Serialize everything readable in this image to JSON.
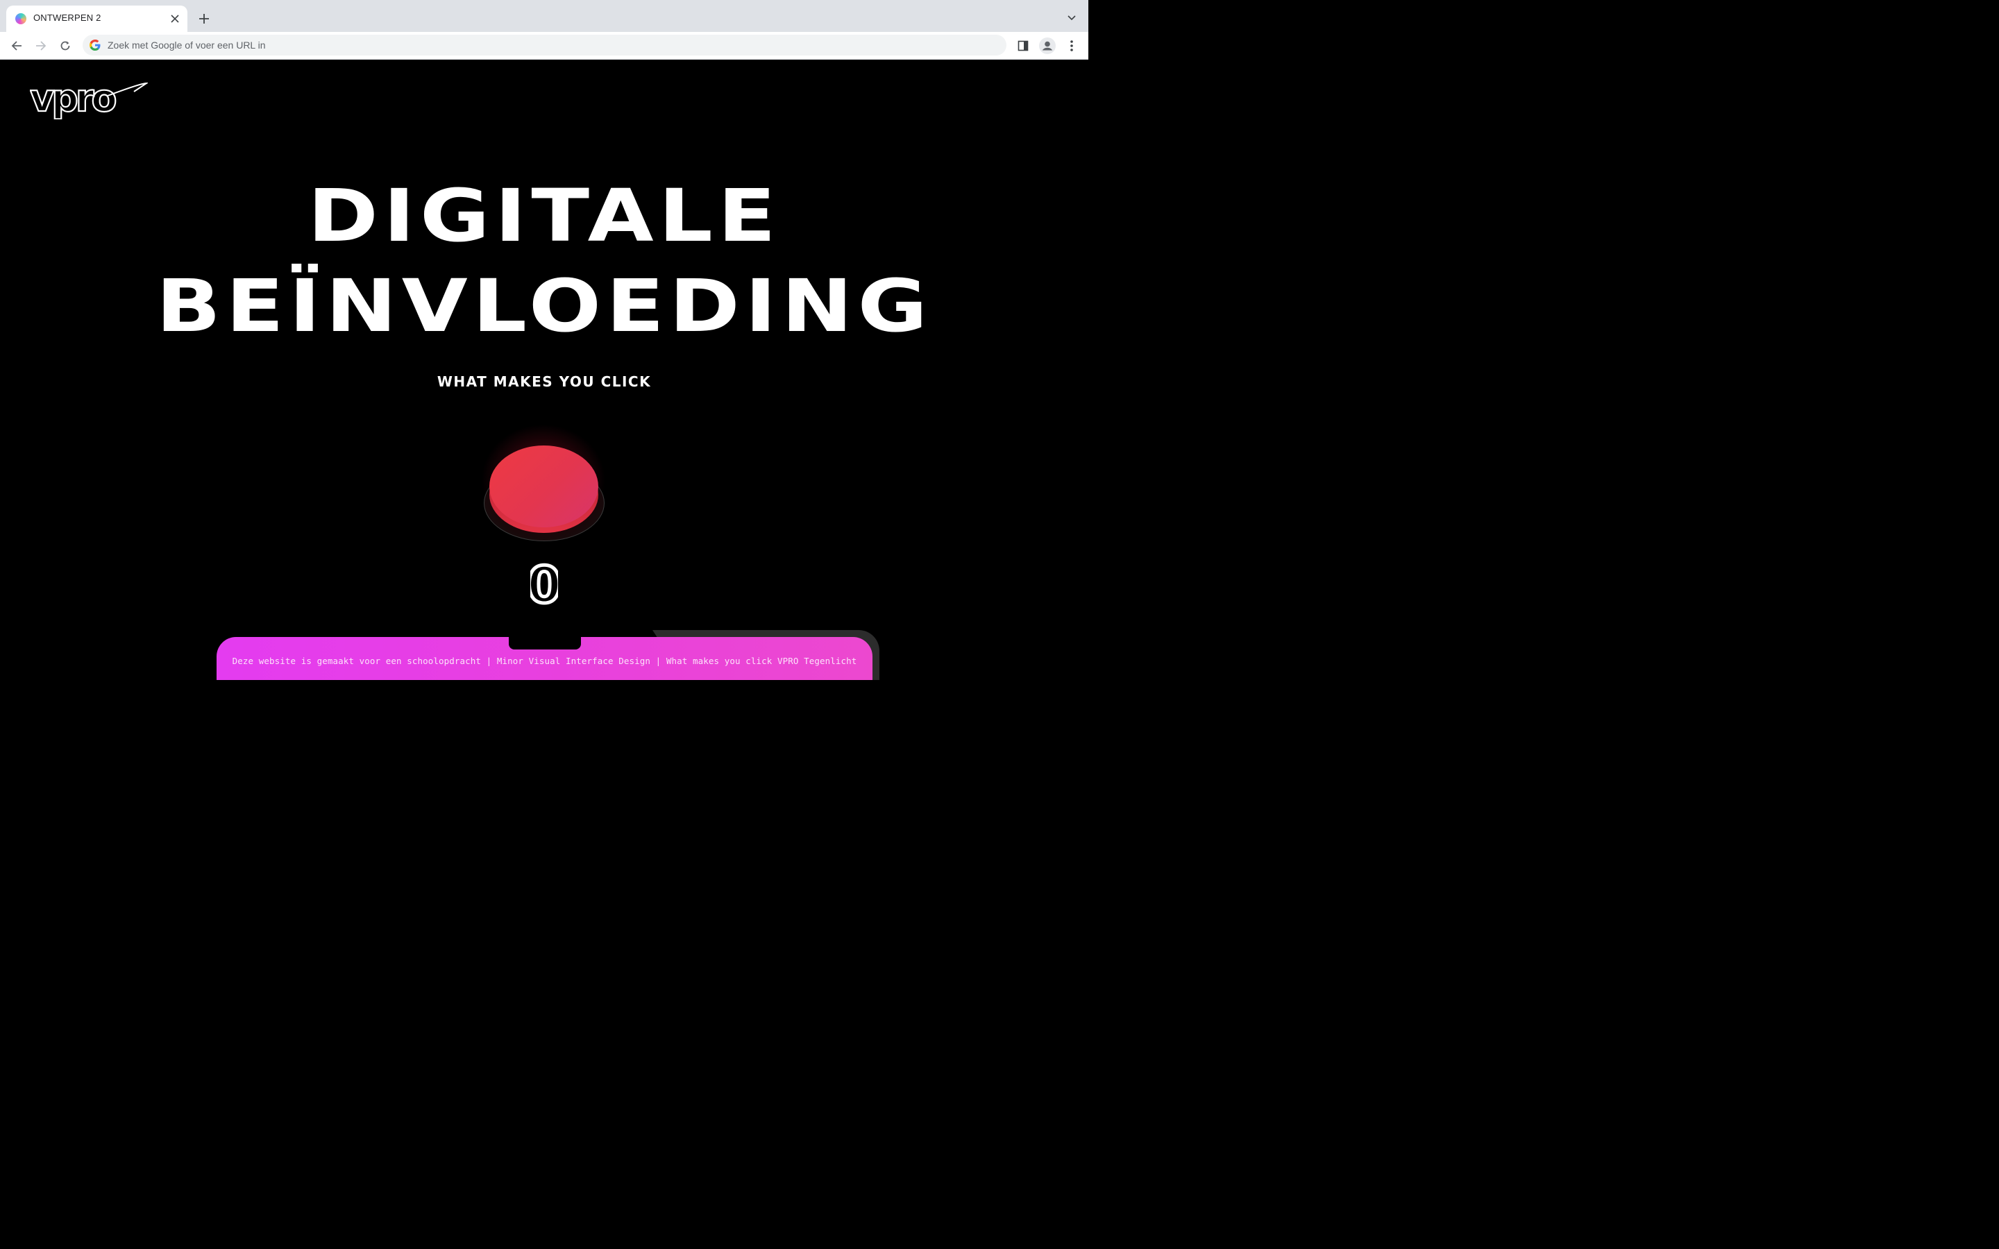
{
  "browser": {
    "tab_title": "ONTWERPEN 2",
    "omnibox_placeholder": "Zoek met Google of voer een URL in",
    "icons": [
      "favicon",
      "close-icon",
      "plus-icon",
      "chevron-down-icon",
      "back-arrow-icon",
      "forward-arrow-icon",
      "reload-icon",
      "google-icon",
      "side-panel-icon",
      "profile-icon",
      "kebab-menu-icon"
    ]
  },
  "page": {
    "logo_text": "vpro",
    "headline_line1": "DIGITALE",
    "headline_line2": "BEÏNVLOEDING",
    "subtitle": "WHAT MAKES YOU CLICK",
    "click_count": "0",
    "footer_text": "Deze website is gemaakt voor een schoolopdracht | Minor Visual Interface Design | What makes you click VPRO Tegenlicht",
    "colors": {
      "background": "#000000",
      "button_red": "#e8384a",
      "footer_magenta": "#e840df",
      "text": "#ffffff"
    }
  }
}
